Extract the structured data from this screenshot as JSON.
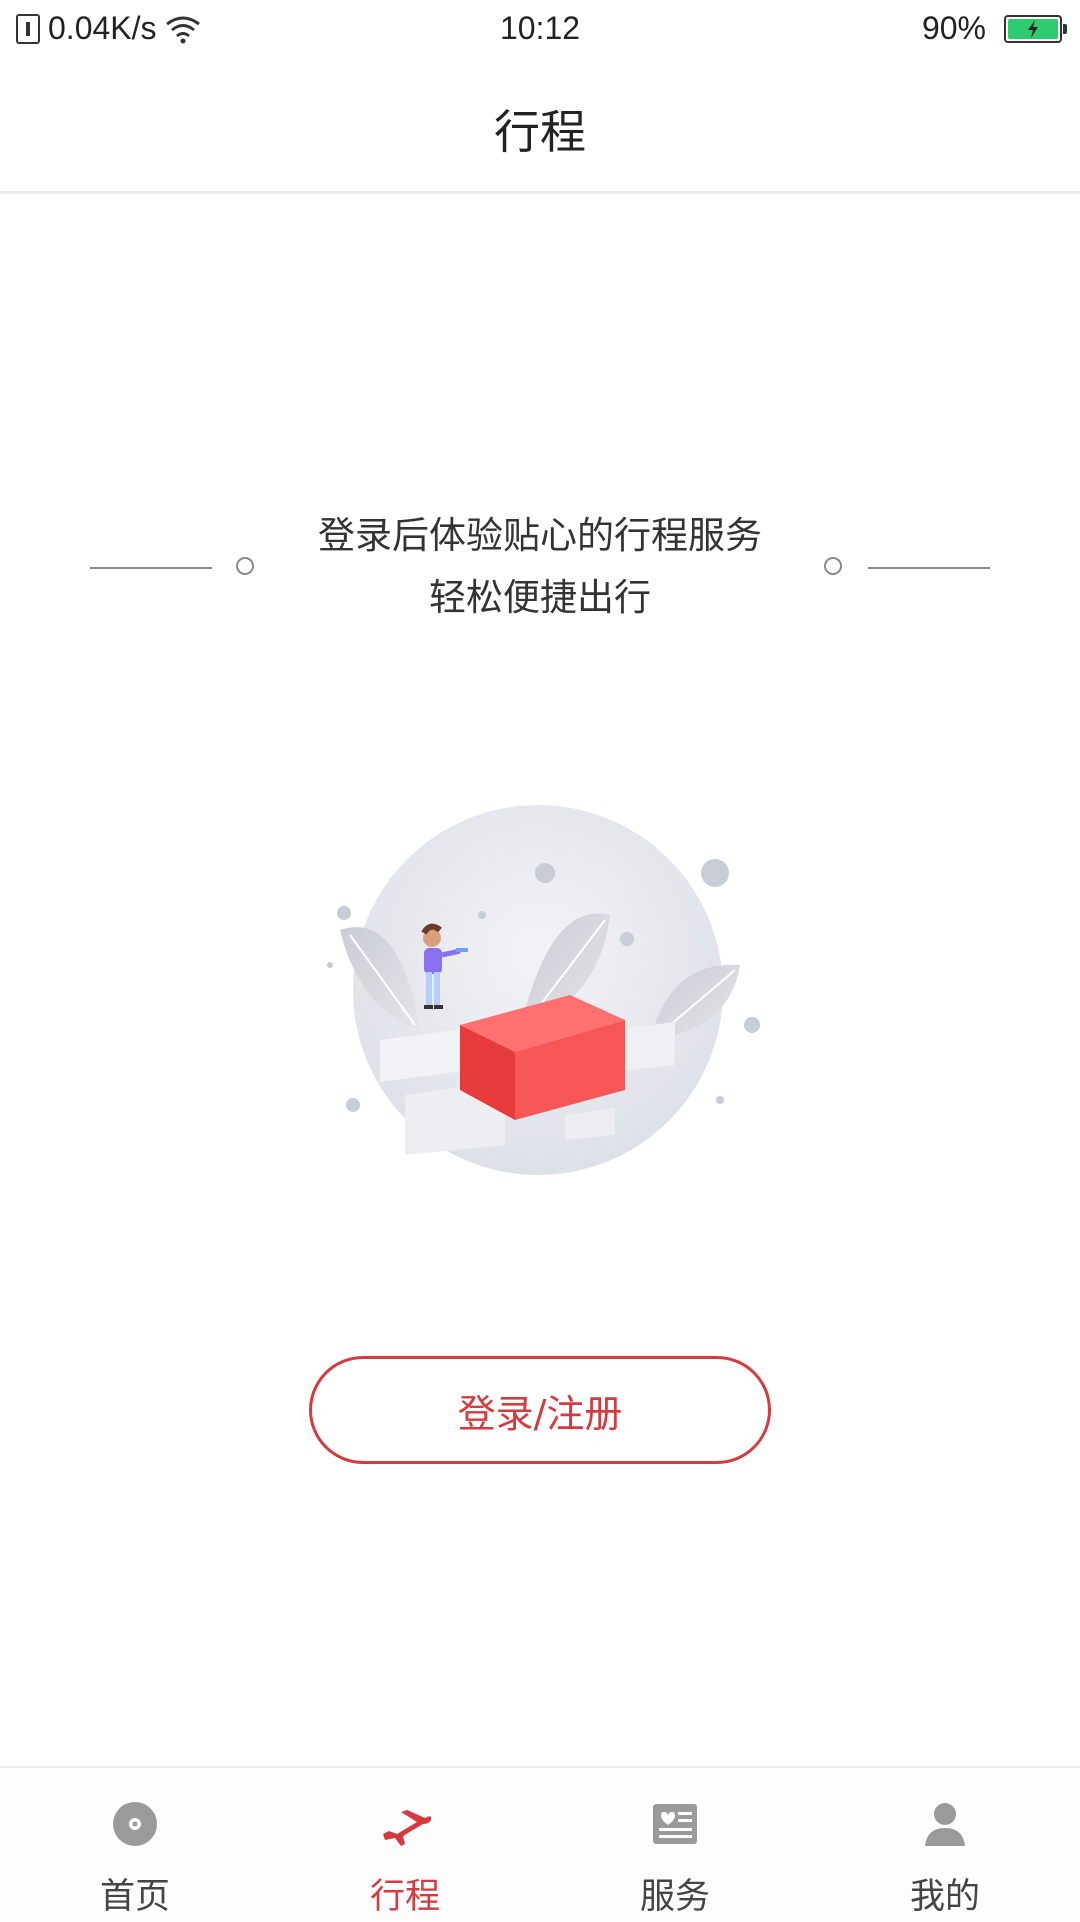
{
  "status_bar": {
    "net_speed": "0.04K/s",
    "time": "10:12",
    "battery": "90%"
  },
  "nav": {
    "title": "行程"
  },
  "content": {
    "line1": "登录后体验贴心的行程服务",
    "line2": "轻松便捷出行",
    "login_button": "登录/注册"
  },
  "colors": {
    "accent": "#d63a3f",
    "inactive": "#9a9a9a"
  },
  "tabs": [
    {
      "label": "首页",
      "icon": "home-icon",
      "active": false
    },
    {
      "label": "行程",
      "icon": "plane-icon",
      "active": true
    },
    {
      "label": "服务",
      "icon": "service-icon",
      "active": false
    },
    {
      "label": "我的",
      "icon": "user-icon",
      "active": false
    }
  ]
}
